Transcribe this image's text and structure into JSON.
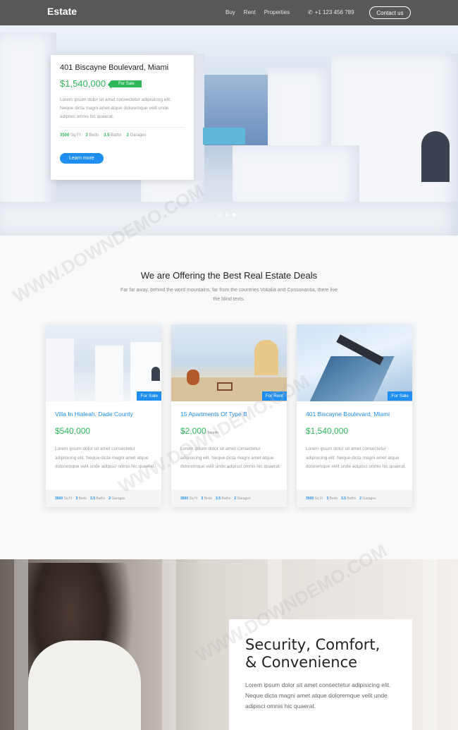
{
  "nav": {
    "brand": "Estate",
    "links": [
      "Buy",
      "Rent",
      "Properties"
    ],
    "phone": "+1 123 456 789",
    "contact": "Contact us"
  },
  "hero": {
    "address": "401 Biscayne Boulevard, Miami",
    "price": "$1,540,000",
    "tag": "For Sale",
    "description": "Lorem ipsum dolor sit amet consectetur adipisicing elit. Neque dicta magni amet atque doloremque velit unde adipisci omnis hic quaerat.",
    "features": [
      {
        "value": "3500",
        "label": "Sq Ft"
      },
      {
        "value": "3",
        "label": "Beds"
      },
      {
        "value": "3.5",
        "label": "Baths"
      },
      {
        "value": "2",
        "label": "Garages"
      }
    ],
    "button": "Learn more",
    "slides": 3,
    "active_slide": 3
  },
  "offers": {
    "title": "We are Offering the Best Real Estate Deals",
    "subtitle": "Far far away, behind the word mountains, far from the countries Vokalia and Consonantia, there live the blind texts.",
    "cards": [
      {
        "badge": "For Sale",
        "title": "Villa In Hialeah, Dade County",
        "price": "$540,000",
        "price_suffix": "",
        "description": "Lorem ipsum dolor sit amet consectetur adipisicing elit. Neque dicta magni amet atque doloremque velit unde adipisci omnis hic quaerat.",
        "features": [
          {
            "value": "3500",
            "label": "Sq Ft"
          },
          {
            "value": "3",
            "label": "Beds"
          },
          {
            "value": "3.5",
            "label": "Baths"
          },
          {
            "value": "2",
            "label": "Garages"
          }
        ]
      },
      {
        "badge": "For Rent",
        "title": "15 Apartments Of Type B",
        "price": "$2,000",
        "price_suffix": "/month",
        "description": "Lorem ipsum dolor sit amet consectetur adipisicing elit. Neque dicta magni amet atque doloremque velit unde adipisci omnis hic quaerat.",
        "features": [
          {
            "value": "3500",
            "label": "Sq Ft"
          },
          {
            "value": "3",
            "label": "Beds"
          },
          {
            "value": "3.5",
            "label": "Baths"
          },
          {
            "value": "2",
            "label": "Garages"
          }
        ]
      },
      {
        "badge": "For Sale",
        "title": "401 Biscayne Boulevard, Miami",
        "price": "$1,540,000",
        "price_suffix": "",
        "description": "Lorem ipsum dolor sit amet consectetur adipisicing elit. Neque dicta magni amet atque doloremque velit unde adipisci omnis hic quaerat.",
        "features": [
          {
            "value": "3500",
            "label": "Sq Ft"
          },
          {
            "value": "3",
            "label": "Beds"
          },
          {
            "value": "3.5",
            "label": "Baths"
          },
          {
            "value": "2",
            "label": "Garages"
          }
        ]
      }
    ]
  },
  "feature": {
    "heading": "Security, Comfort, & Convenience",
    "text": "Lorem ipsum dolor sit amet consectetur adipisicing elit. Neque dicta magni amet atque doloremque velit unde adipisci omnis hic quaerat."
  },
  "watermark": "WWW.DOWNDEMO.COM",
  "colors": {
    "accent": "#1e8ef0",
    "price": "#2eb85c"
  }
}
